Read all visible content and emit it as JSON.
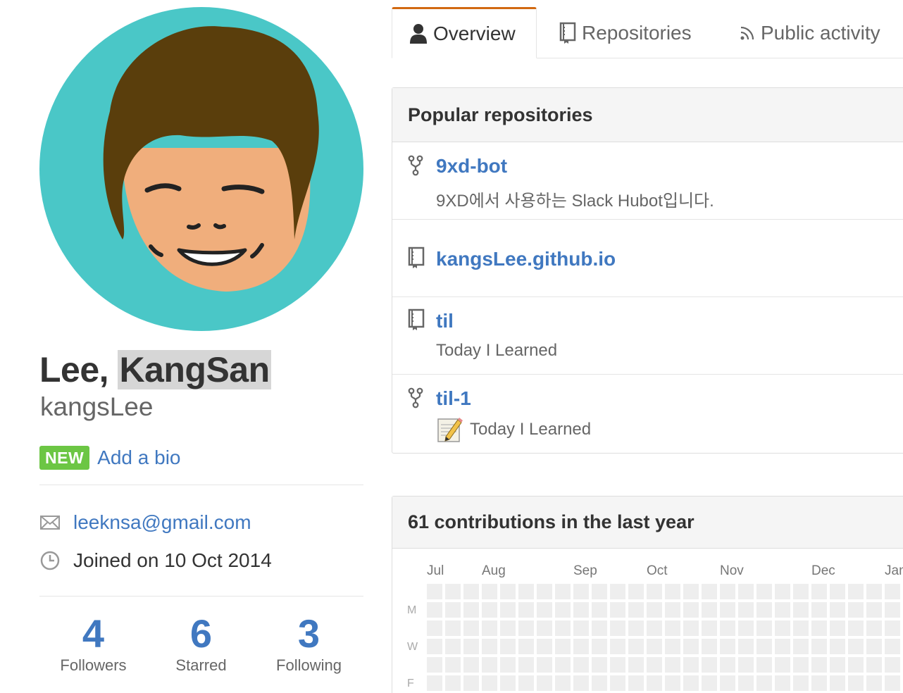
{
  "profile": {
    "name_part1": "Lee, ",
    "name_part2": "KangSan",
    "username": "kangsLee",
    "new_badge": "NEW",
    "add_bio": "Add a bio",
    "email": "leeknsa@gmail.com",
    "joined": "Joined on 10 Oct 2014",
    "avatar_icon": "avatar-cartoon-face",
    "stats": [
      {
        "value": "4",
        "label": "Followers"
      },
      {
        "value": "6",
        "label": "Starred"
      },
      {
        "value": "3",
        "label": "Following"
      }
    ]
  },
  "tabs": [
    {
      "label": "Overview",
      "icon": "person-icon",
      "selected": true
    },
    {
      "label": "Repositories",
      "icon": "repo-book-icon",
      "selected": false
    },
    {
      "label": "Public activity",
      "icon": "rss-icon",
      "selected": false
    }
  ],
  "popular": {
    "title": "Popular repositories",
    "repos": [
      {
        "name": "9xd-bot",
        "description": "9XD에서 사용하는 Slack Hubot입니다.",
        "icon": "fork-icon"
      },
      {
        "name": "kangsLee.github.io",
        "description": "",
        "icon": "repo-book-icon"
      },
      {
        "name": "til",
        "description": "Today I Learned",
        "icon": "repo-book-icon"
      },
      {
        "name": "til-1",
        "description": "Today I Learned",
        "icon": "fork-icon",
        "emoji": "memo-icon"
      }
    ]
  },
  "contributions": {
    "title": "61 contributions in the last year",
    "months": [
      "Jul",
      "Aug",
      "Sep",
      "Oct",
      "Nov",
      "Dec",
      "Jan"
    ],
    "days": [
      "M",
      "W",
      "F"
    ]
  },
  "colors": {
    "link": "#4078c0",
    "new_badge": "#6cc644",
    "avatar_bg": "#4ac7c7",
    "hair": "#5a3e0c",
    "skin": "#f0ae7c",
    "cell_empty": "#eeeeee"
  }
}
